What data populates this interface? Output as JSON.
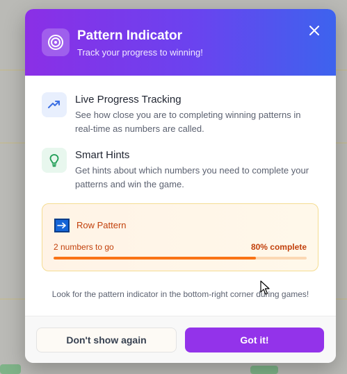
{
  "modal": {
    "title": "Pattern Indicator",
    "subtitle": "Track your progress to winning!",
    "close_icon": "close-icon",
    "header_icon": "target-icon"
  },
  "features": [
    {
      "icon": "trending-up-icon",
      "title": "Live Progress Tracking",
      "description": "See how close you are to completing winning patterns in real-time as numbers are called."
    },
    {
      "icon": "lightbulb-icon",
      "title": "Smart Hints",
      "description": "Get hints about which numbers you need to complete your patterns and win the game."
    }
  ],
  "pattern_card": {
    "icon": "arrow-right-icon",
    "title": "Row Pattern",
    "remaining": "2 numbers to go",
    "complete_label": "80% complete",
    "progress": 0.8
  },
  "hint": "Look for the pattern indicator in the bottom-right corner during games!",
  "footer": {
    "secondary_label": "Don't show again",
    "primary_label": "Got it!"
  },
  "colors": {
    "gradient_start": "#8b2fe6",
    "gradient_end": "#3d63ee",
    "primary_button": "#9333ea",
    "progress_fill": "#f97316",
    "pattern_text": "#c2410c"
  }
}
